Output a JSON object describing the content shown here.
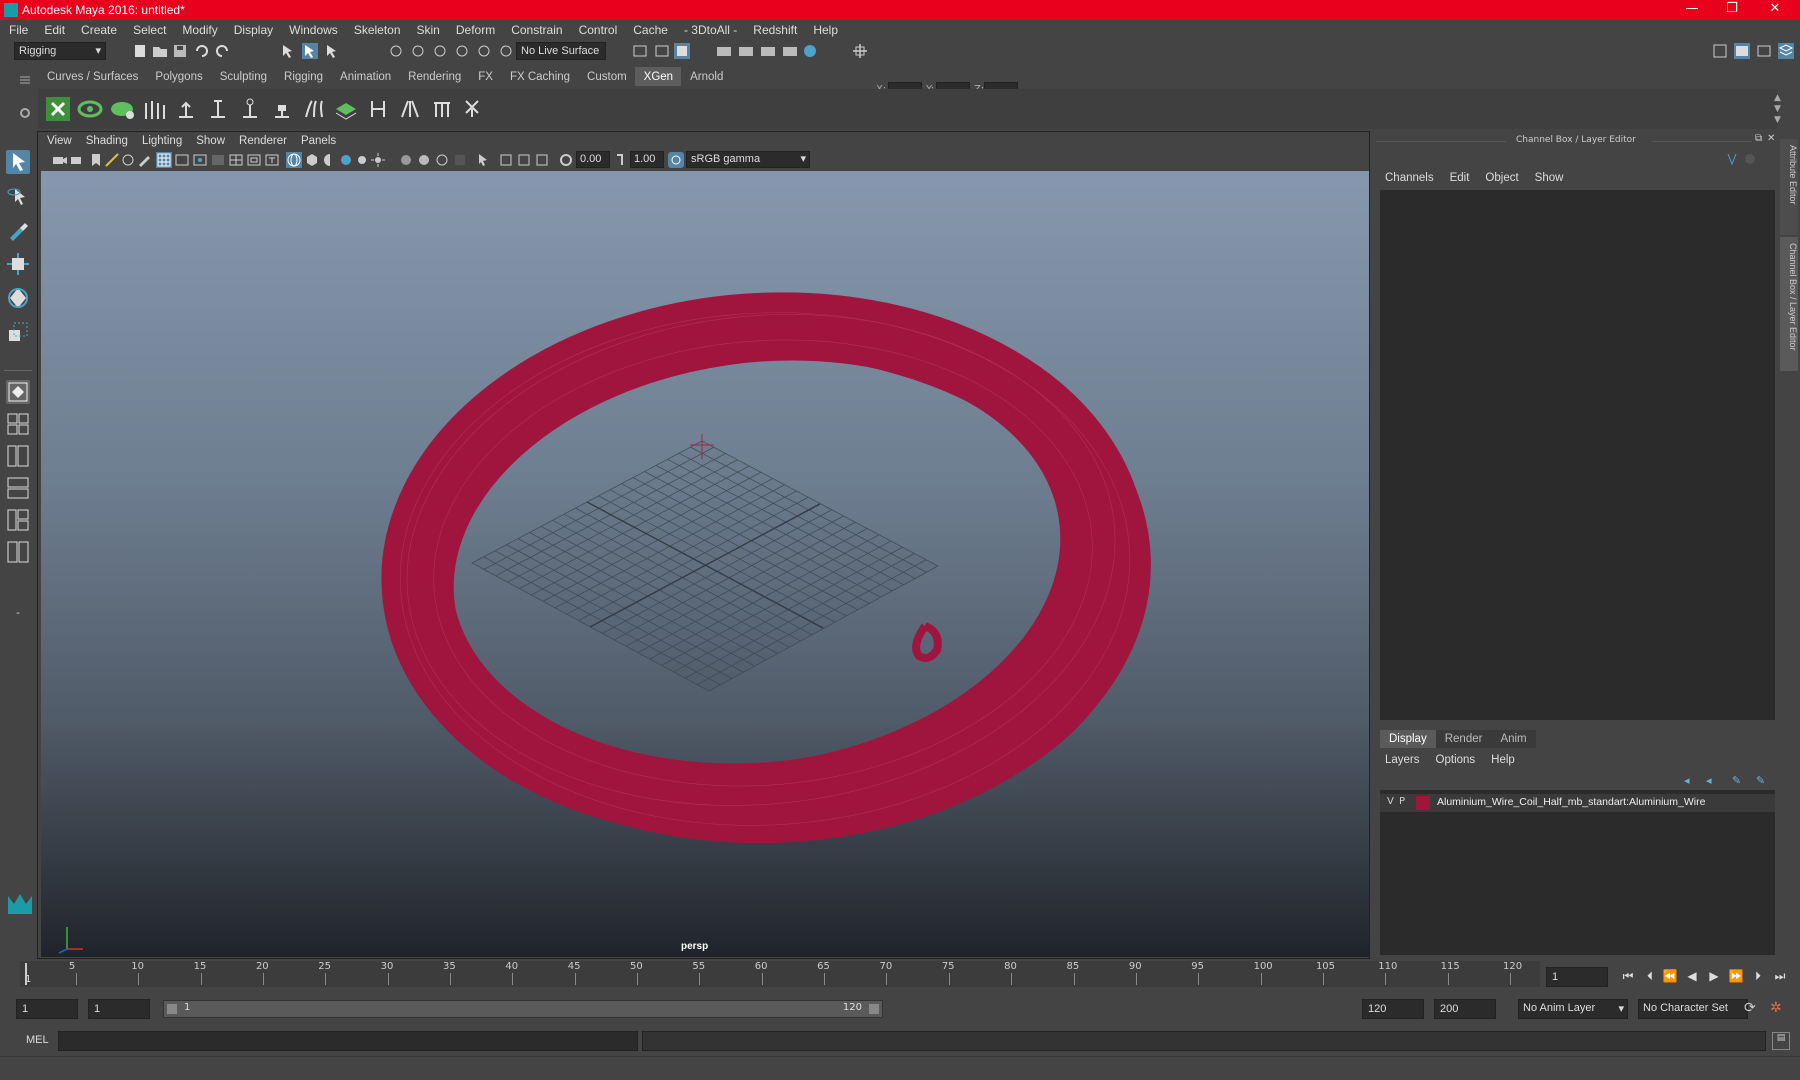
{
  "window": {
    "title": "Autodesk Maya 2016: untitled*",
    "minimize": "—",
    "maximize": "❐",
    "close": "✕"
  },
  "menubar": [
    "File",
    "Edit",
    "Create",
    "Select",
    "Modify",
    "Display",
    "Windows",
    "Skeleton",
    "Skin",
    "Deform",
    "Constrain",
    "Control",
    "Cache",
    "- 3DtoAll -",
    "Redshift",
    "Help"
  ],
  "statusline": {
    "menuset": "Rigging",
    "live_surface": "No Live Surface",
    "x_label": "X:",
    "y_label": "Y:",
    "z_label": "Z:"
  },
  "shelf": {
    "tabs": [
      "Curves / Surfaces",
      "Polygons",
      "Sculpting",
      "Rigging",
      "Animation",
      "Rendering",
      "FX",
      "FX Caching",
      "Custom",
      "XGen",
      "Arnold"
    ],
    "active_tab": "XGen"
  },
  "viewport": {
    "menu": [
      "View",
      "Shading",
      "Lighting",
      "Show",
      "Renderer",
      "Panels"
    ],
    "exposure": "0.00",
    "gamma": "1.00",
    "color_space": "sRGB gamma",
    "camera_label": "persp"
  },
  "channel_box": {
    "title": "Channel Box / Layer Editor",
    "menu": [
      "Channels",
      "Edit",
      "Object",
      "Show"
    ]
  },
  "layer_editor": {
    "tabs": [
      "Display",
      "Render",
      "Anim"
    ],
    "active_tab": "Display",
    "menu": [
      "Layers",
      "Options",
      "Help"
    ],
    "layers": [
      {
        "v": "V",
        "p": "P",
        "color": "#a0153e",
        "name": "Aluminium_Wire_Coil_Half_mb_standart:Aluminium_Wire"
      }
    ]
  },
  "side_tabs": [
    "Attribute Editor",
    "Channel Box / Layer Editor"
  ],
  "timeline": {
    "ticks": [
      "5",
      "10",
      "15",
      "20",
      "25",
      "30",
      "35",
      "40",
      "45",
      "50",
      "55",
      "60",
      "65",
      "70",
      "75",
      "80",
      "85",
      "90",
      "95",
      "100",
      "105",
      "110",
      "115",
      "120"
    ],
    "current_frame_marker": "1",
    "current_frame": "1"
  },
  "range": {
    "start": "1",
    "playback_start": "1",
    "slider_start": "1",
    "slider_end": "120",
    "playback_end": "120",
    "end": "200",
    "anim_layer": "No Anim Layer",
    "character_set": "No Character Set"
  },
  "command_line": {
    "mode": "MEL"
  },
  "colors": {
    "title_bar": "#e8001c",
    "wire": "#a0153e",
    "accent": "#5285a6"
  }
}
